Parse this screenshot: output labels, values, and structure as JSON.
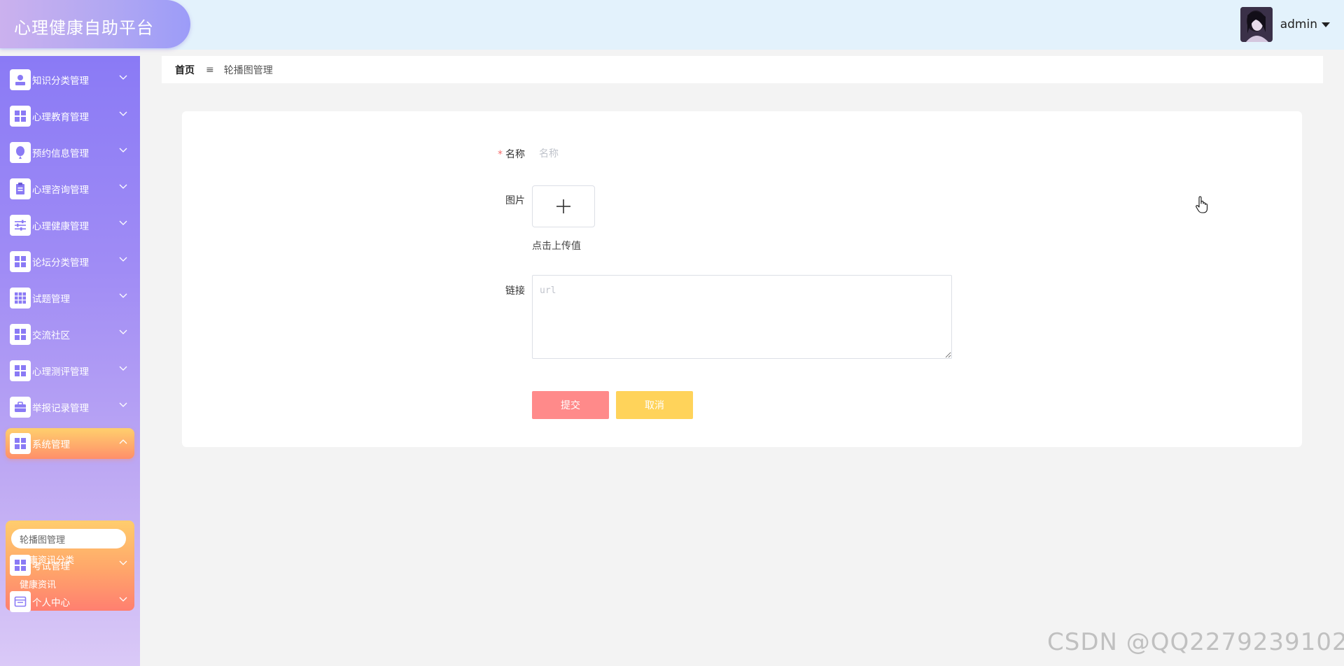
{
  "header": {
    "app_title": "心理健康自助平台",
    "username": "admin"
  },
  "sidebar": {
    "items": [
      {
        "label": "知识分类管理",
        "icon": "user-badge-icon"
      },
      {
        "label": "心理教育管理",
        "icon": "grid-icon"
      },
      {
        "label": "预约信息管理",
        "icon": "balloon-icon"
      },
      {
        "label": "心理咨询管理",
        "icon": "clipboard-icon"
      },
      {
        "label": "心理健康管理",
        "icon": "sliders-icon"
      },
      {
        "label": "论坛分类管理",
        "icon": "grid-icon"
      },
      {
        "label": "试题管理",
        "icon": "grid-nine-icon"
      },
      {
        "label": "交流社区",
        "icon": "grid-icon"
      },
      {
        "label": "心理测评管理",
        "icon": "grid-icon"
      },
      {
        "label": "举报记录管理",
        "icon": "briefcase-icon"
      },
      {
        "label": "系统管理",
        "icon": "grid-icon"
      },
      {
        "label": "考试管理",
        "icon": "grid-icon"
      },
      {
        "label": "个人中心",
        "icon": "window-icon"
      }
    ],
    "submenu": [
      {
        "label": "轮播图管理"
      },
      {
        "label": "健康资讯分类"
      },
      {
        "label": "健康资讯"
      }
    ]
  },
  "breadcrumb": {
    "home": "首页",
    "separator": "≡",
    "current": "轮播图管理"
  },
  "form": {
    "name_label": "名称",
    "name_required_mark": "*",
    "name_placeholder": "名称",
    "image_label": "图片",
    "upload_hint": "点击上传值",
    "link_label": "链接",
    "link_placeholder": "url",
    "submit_label": "提交",
    "cancel_label": "取消"
  },
  "watermark": "CSDN @QQ2279239102",
  "colors": {
    "header_bg": "#e3f2fc",
    "sidebar_top": "#8a7af5",
    "active_orange": "#ff8f6a",
    "submit_button": "#ff8a8a",
    "cancel_button": "#ffd35a"
  }
}
